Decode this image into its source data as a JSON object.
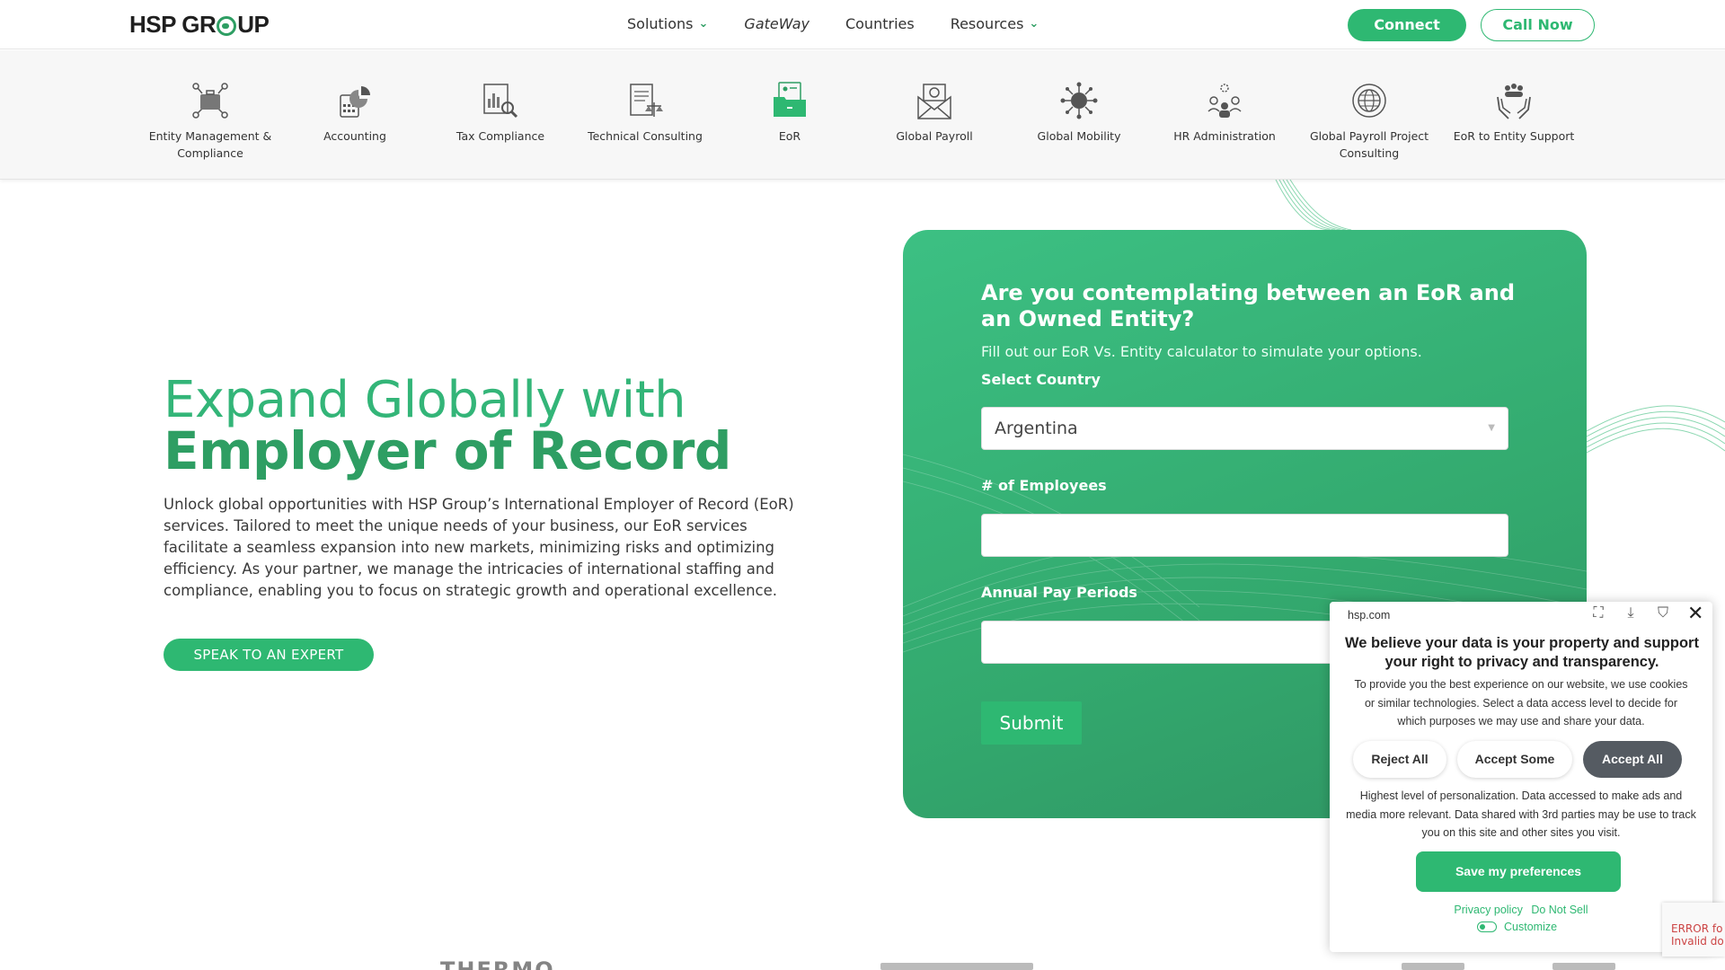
{
  "header": {
    "logo_text": "HSP GR",
    "logo_text_end": "UP",
    "nav": [
      {
        "label": "Solutions",
        "has_dropdown": true
      },
      {
        "label": "GateWay",
        "has_dropdown": false
      },
      {
        "label": "Countries",
        "has_dropdown": false
      },
      {
        "label": "Resources",
        "has_dropdown": true
      }
    ],
    "connect_label": "Connect",
    "call_label": "Call Now"
  },
  "services": [
    {
      "label": "Entity Management & Compliance",
      "icon": "briefcase-network-icon"
    },
    {
      "label": "Accounting",
      "icon": "calculator-chart-icon"
    },
    {
      "label": "Tax Compliance",
      "icon": "document-magnifier-icon"
    },
    {
      "label": "Technical Consulting",
      "icon": "document-scales-icon"
    },
    {
      "label": "EoR",
      "icon": "folder-id-icon"
    },
    {
      "label": "Global Payroll",
      "icon": "envelope-money-icon"
    },
    {
      "label": "Global Mobility",
      "icon": "globe-network-icon"
    },
    {
      "label": "HR Administration",
      "icon": "people-gear-icon"
    },
    {
      "label": "Global Payroll Project Consulting",
      "icon": "globe-arrows-icon"
    },
    {
      "label": "EoR to Entity Support",
      "icon": "hands-people-icon"
    }
  ],
  "hero": {
    "line1": "Expand Globally with",
    "line2": "Employer of Record",
    "description": "Unlock global opportunities with HSP Group’s International Employer of Record (EoR) services. Tailored to meet the unique needs of your business, our EoR services facilitate a seamless expansion into new markets, minimizing risks and optimizing efficiency. As your partner, we manage the intricacies of international staffing and compliance, enabling you to focus on strategic growth and operational excellence.",
    "cta_label": "SPEAK TO AN EXPERT"
  },
  "form": {
    "title": "Are you contemplating between an EoR and an Owned Entity?",
    "subtitle": "Fill out our EoR Vs. Entity calculator to simulate your options.",
    "country_label": "Select Country",
    "country_value": "Argentina",
    "employees_label": "# of Employees",
    "employees_value": "",
    "pay_periods_label": "Annual Pay Periods",
    "pay_periods_value": "",
    "submit_label": "Submit"
  },
  "cookie": {
    "site": "hsp.com",
    "heading": "We believe your data is your property and support your right to privacy and transparency.",
    "body": "To provide you the best experience on our website, we use cookies or similar technologies. Select a data access level to decide for which purposes we may use and share your data.",
    "reject_label": "Reject All",
    "some_label": "Accept Some",
    "all_label": "Accept All",
    "level_desc": "Highest level of personalization. Data accessed to make ads and media more relevant. Data shared with 3rd parties may be use to track you on this site and other sites you visit.",
    "save_label": "Save my preferences",
    "privacy_label": "Privacy policy",
    "donotsell_label": "Do Not Sell",
    "customize_label": "Customize"
  },
  "recaptcha_text_1": "ERROR fo",
  "recaptcha_text_2": "Invalid do",
  "partner_text": "THERMO",
  "colors": {
    "brand_green": "#2eb872",
    "dark_green": "#2e9e63",
    "button_dark": "#555b62"
  }
}
